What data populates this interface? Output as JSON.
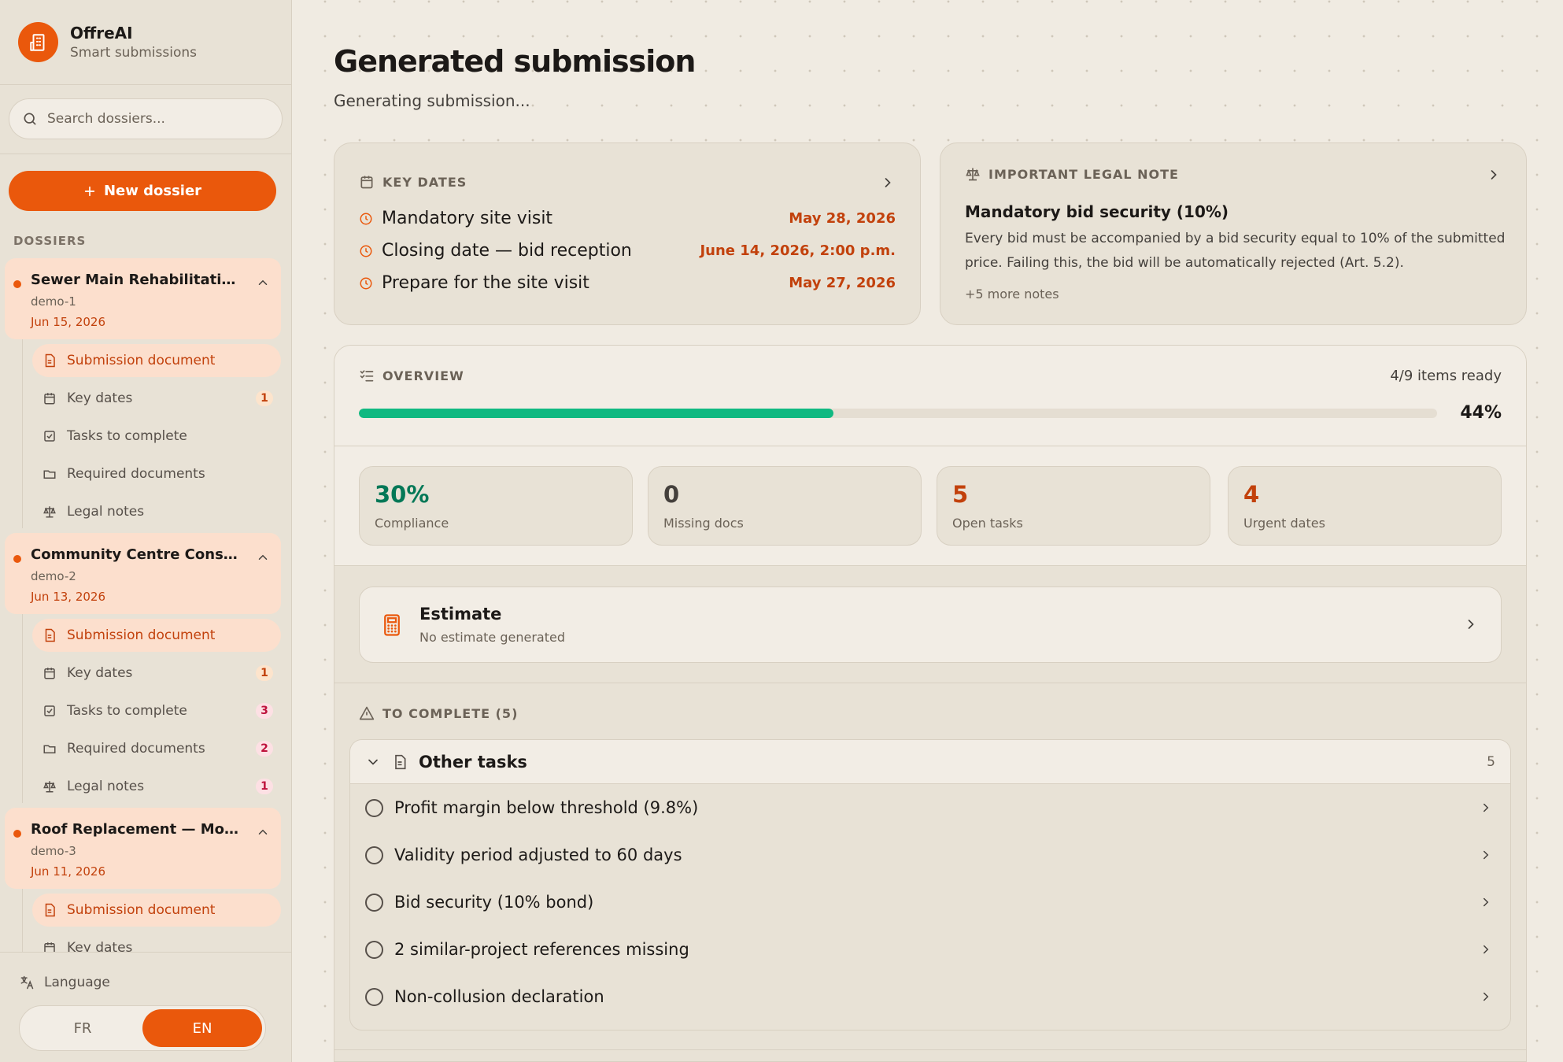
{
  "app": {
    "name": "OffreAI",
    "tagline": "Smart submissions"
  },
  "search": {
    "placeholder": "Search dossiers..."
  },
  "new_dossier_label": "New dossier",
  "dossiers_label": "DOSSIERS",
  "dossiers": [
    {
      "title": "Sewer Main Rehabilitation — ...",
      "code": "demo-1",
      "date": "Jun 15, 2026",
      "items": [
        {
          "label": "Submission document",
          "icon": "document-icon",
          "badge": ""
        },
        {
          "label": "Key dates",
          "icon": "calendar-icon",
          "badge": "1"
        },
        {
          "label": "Tasks to complete",
          "icon": "checkbox-icon",
          "badge": ""
        },
        {
          "label": "Required documents",
          "icon": "folder-icon",
          "badge": ""
        },
        {
          "label": "Legal notes",
          "icon": "scale-icon",
          "badge": ""
        }
      ]
    },
    {
      "title": "Community Centre Construct...",
      "code": "demo-2",
      "date": "Jun 13, 2026",
      "items": [
        {
          "label": "Submission document",
          "icon": "document-icon",
          "badge": ""
        },
        {
          "label": "Key dates",
          "icon": "calendar-icon",
          "badge": "1"
        },
        {
          "label": "Tasks to complete",
          "icon": "checkbox-icon",
          "badge": "3"
        },
        {
          "label": "Required documents",
          "icon": "folder-icon",
          "badge": "2"
        },
        {
          "label": "Legal notes",
          "icon": "scale-icon",
          "badge": "1"
        }
      ]
    },
    {
      "title": "Roof Replacement — Mont-R...",
      "code": "demo-3",
      "date": "Jun 11, 2026",
      "items": [
        {
          "label": "Submission document",
          "icon": "document-icon",
          "badge": ""
        },
        {
          "label": "Key dates",
          "icon": "calendar-icon",
          "badge": ""
        }
      ]
    }
  ],
  "language": {
    "label": "Language",
    "options": [
      "FR",
      "EN"
    ],
    "selected": "EN"
  },
  "page": {
    "title": "Generated submission",
    "status": "Generating submission..."
  },
  "key_dates": {
    "caption": "KEY DATES",
    "rows": [
      {
        "label": "Mandatory site visit",
        "date": "May 28, 2026"
      },
      {
        "label": "Closing date — bid reception",
        "date": "June 14, 2026, 2:00 p.m."
      },
      {
        "label": "Prepare for the site visit",
        "date": "May 27, 2026"
      }
    ]
  },
  "legal_note": {
    "caption": "IMPORTANT LEGAL NOTE",
    "title": "Mandatory bid security (10%)",
    "body": "Every bid must be accompanied by a bid security equal to 10% of the submitted price. Failing this, the bid will be automatically rejected (Art. 5.2).",
    "more": "+5 more notes"
  },
  "overview": {
    "caption": "OVERVIEW",
    "ready_text": "4/9 items ready",
    "percent_label": "44%",
    "progress": 0.44
  },
  "stats": [
    {
      "value": "30%",
      "label": "Compliance",
      "color": "#047857"
    },
    {
      "value": "0",
      "label": "Missing docs",
      "color": "#44403c"
    },
    {
      "value": "5",
      "label": "Open tasks",
      "color": "#c2410c"
    },
    {
      "value": "4",
      "label": "Urgent dates",
      "color": "#c2410c"
    }
  ],
  "estimate": {
    "title": "Estimate",
    "subtitle": "No estimate generated"
  },
  "to_complete": {
    "caption": "TO COMPLETE (5)",
    "group": "Other tasks",
    "count": "5",
    "tasks": [
      "Profit margin below threshold (9.8%)",
      "Validity period adjusted to 60 days",
      "Bid security (10% bond)",
      "2 similar-project references missing",
      "Non-collusion declaration"
    ]
  },
  "colors": {
    "accent": "#ea580c",
    "progress": "#10b981",
    "sidebar_bg": "#e8e2d6",
    "page_bg": "#f0ebe2"
  }
}
